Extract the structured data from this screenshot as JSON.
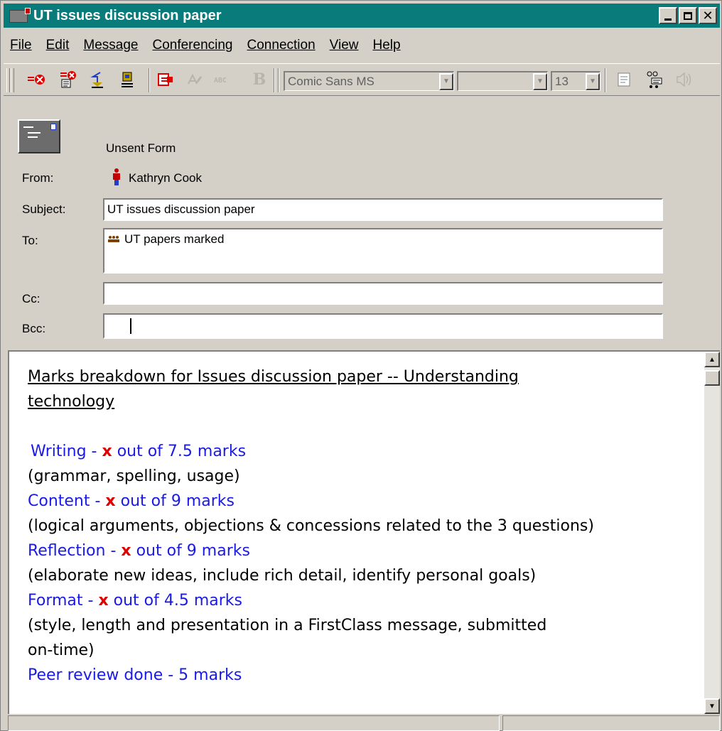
{
  "window": {
    "title": "UT issues discussion paper",
    "colors": {
      "titlebar": "#0a7b7b",
      "chrome": "#d4d0c8",
      "link_blue": "#1a1ae6",
      "mark_red": "#e00000"
    }
  },
  "menu": {
    "items": [
      "File",
      "Edit",
      "Message",
      "Conferencing",
      "Connection",
      "View",
      "Help"
    ]
  },
  "toolbar": {
    "font_name": "Comic Sans MS",
    "font_style": "",
    "font_size": "13",
    "icons": [
      "send-icon",
      "send-later-icon",
      "reply-icon",
      "forward-icon",
      "attach-icon",
      "spell-check-icon",
      "format-icon",
      "bold-icon",
      "properties-icon",
      "address-book-icon",
      "speaker-icon"
    ]
  },
  "header": {
    "form_status": "Unsent Form",
    "from_label": "From:",
    "from_value": "Kathryn Cook",
    "subject_label": "Subject:",
    "subject_value": "UT issues discussion paper",
    "to_label": "To:",
    "to_value": "UT papers marked",
    "cc_label": "Cc:",
    "cc_value": "",
    "bcc_label": "Bcc:",
    "bcc_value": ""
  },
  "body": {
    "title_line1": "Marks breakdown for Issues discussion paper -- Understanding",
    "title_line2": "technology",
    "mark_symbol": "x",
    "criteria": [
      {
        "label_pre": "Writing - ",
        "label_post": " out of 7.5 marks",
        "desc": "(grammar, spelling, usage)"
      },
      {
        "label_pre": "Content - ",
        "label_post": " out of 9 marks",
        "desc": "(logical arguments, objections & concessions related to the 3 questions)"
      },
      {
        "label_pre": "Reflection - ",
        "label_post": " out of 9 marks",
        "desc": "(elaborate new ideas, include rich detail, identify personal goals)"
      },
      {
        "label_pre": "Format - ",
        "label_post": " out of 4.5 marks",
        "desc_line1": "(style, length and presentation in a FirstClass message, submitted",
        "desc_line2": "on-time)"
      }
    ],
    "peer_review": "Peer review done - 5 marks"
  }
}
